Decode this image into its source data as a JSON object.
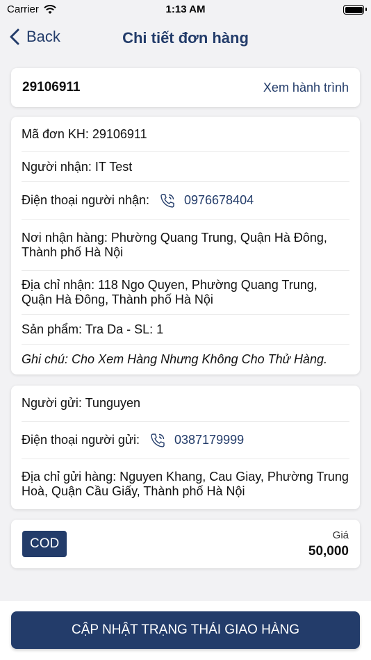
{
  "status_bar": {
    "carrier": "Carrier",
    "time": "1:13 AM"
  },
  "nav": {
    "back_label": "Back",
    "title": "Chi tiết đơn hàng"
  },
  "order": {
    "code": "29106911",
    "track_label": "Xem hành trình"
  },
  "receiver": {
    "customer_code": "Mã đơn KH: 29106911",
    "name": "Người nhận: IT Test",
    "phone_label": "Điện thoại người nhận:",
    "phone": "0976678404",
    "place": "Nơi nhận hàng: Phường Quang Trung, Quận Hà Đông, Thành phố Hà Nội",
    "address": "Địa chỉ nhận: 118 Ngo Quyen, Phường Quang Trung, Quận Hà Đông, Thành phố Hà Nội",
    "product": "Sản phẩm: Tra Da - SL: 1",
    "note": "Ghi chú: Cho Xem Hàng Nhưng Không Cho Thử Hàng."
  },
  "sender": {
    "name": "Người gửi: Tunguyen",
    "phone_label": "Điện thoại người gửi:",
    "phone": "0387179999",
    "address": "Địa chỉ gửi hàng: Nguyen Khang, Cau Giay, Phường Trung Hoà, Quận Cầu Giấy, Thành phố Hà Nội"
  },
  "payment": {
    "type": "COD",
    "price_label": "Giá",
    "price": "50,000"
  },
  "action": {
    "update_label": "CẬP NHẬT TRẠNG THÁI GIAO HÀNG"
  },
  "colors": {
    "primary": "#233c6a",
    "background": "#f2f2f4"
  },
  "icons": {
    "wifi": "wifi-icon",
    "battery": "battery-icon",
    "back": "chevron-left-icon",
    "phone": "phone-icon"
  }
}
